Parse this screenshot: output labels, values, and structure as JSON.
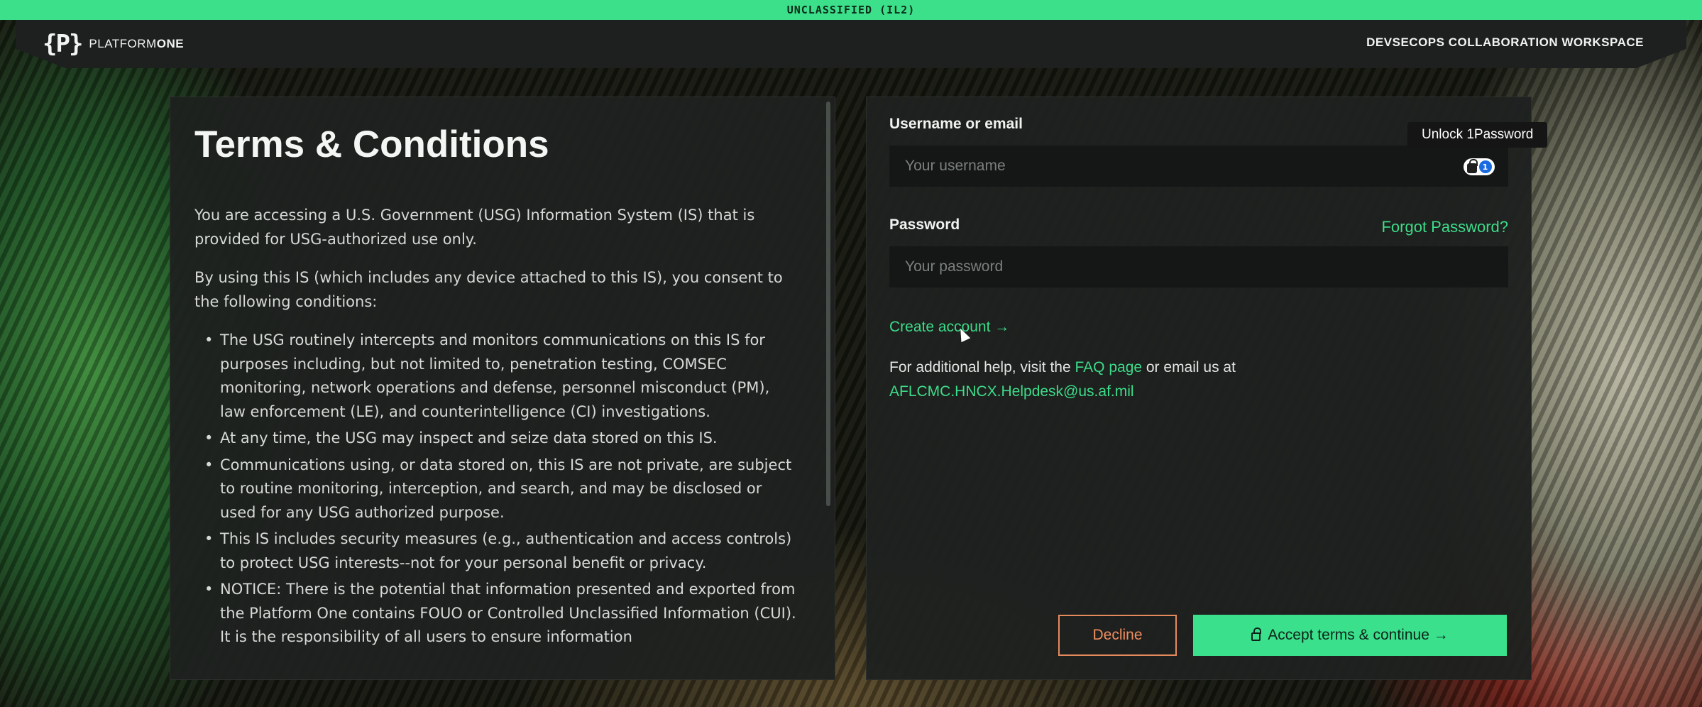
{
  "classification_banner": "UNCLASSIFIED (IL2)",
  "header": {
    "logo_mark": "{P}",
    "logo_text_regular": "PLATFORM",
    "logo_text_bold": "ONE",
    "workspace_title": "DEVSECOPS COLLABORATION WORKSPACE"
  },
  "terms": {
    "title": "Terms & Conditions",
    "paragraphs": [
      "You are accessing a U.S. Government (USG) Information System (IS) that is provided for USG-authorized use only.",
      "By using this IS (which includes any device attached to this IS), you consent to the following conditions:"
    ],
    "bullets": [
      "The USG routinely intercepts and monitors communications on this IS for purposes including, but not limited to, penetration testing, COMSEC monitoring, network operations and defense, personnel misconduct (PM), law enforcement (LE), and counterintelligence (CI) investigations.",
      "At any time, the USG may inspect and seize data stored on this IS.",
      "Communications using, or data stored on, this IS are not private, are subject to routine monitoring, interception, and search, and may be disclosed or used for any USG authorized purpose.",
      "This IS includes security measures (e.g., authentication and access controls) to protect USG interests--not for your personal benefit or privacy.",
      "NOTICE: There is the potential that information presented and exported from the Platform One contains FOUO or Controlled Unclassified Information (CUI). It is the responsibility of all users to ensure information"
    ]
  },
  "login": {
    "username_label": "Username or email",
    "username_placeholder": "Your username",
    "username_value": "",
    "password_label": "Password",
    "password_placeholder": "Your password",
    "password_value": "",
    "forgot_password": "Forgot Password?",
    "create_account": "Create account →",
    "help_prefix": "For additional help, visit the ",
    "faq_link": "FAQ page",
    "help_middle": " or email us at",
    "help_email": "AFLCMC.HNCX.Helpdesk@us.af.mil",
    "password_manager_tooltip": "Unlock 1Password",
    "password_manager_badge": "1"
  },
  "buttons": {
    "decline": "Decline",
    "accept": "Accept terms & continue →"
  },
  "colors": {
    "accent": "#3ddc8a",
    "decline": "#f08e5e",
    "panel": "#1e211f"
  }
}
